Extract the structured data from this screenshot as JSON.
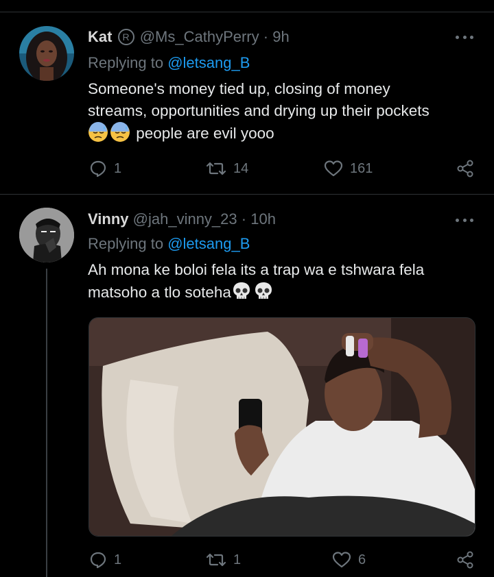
{
  "tweets": [
    {
      "name": "Kat",
      "handle": "@Ms_CathyPerry",
      "time": "9h",
      "replying_prefix": "Replying to",
      "replying_to": "@letsang_B",
      "text_lines": [
        "Someone's money tied up, closing of money",
        "streams, opportunities and drying up their pockets"
      ],
      "text_tail": "people are evil yooo",
      "emojis": [
        "downcast-face-with-sweat",
        "downcast-face-with-sweat"
      ],
      "counts": {
        "replies": "1",
        "retweets": "14",
        "likes": "161"
      }
    },
    {
      "name": "Vinny",
      "handle": "@jah_vinny_23",
      "time": "10h",
      "replying_prefix": "Replying to",
      "replying_to": "@letsang_B",
      "text_lines": [
        "Ah mona ke boloi fela its a trap wa e tshwara fela",
        "matsoho a tlo soteha"
      ],
      "emojis": [
        "skull",
        "skull"
      ],
      "counts": {
        "replies": "1",
        "retweets": "1",
        "likes": "6"
      }
    }
  ],
  "colors": {
    "background": "#000000",
    "link": "#1d9bf0",
    "muted": "#6e767d",
    "text": "#e7e9ea"
  }
}
